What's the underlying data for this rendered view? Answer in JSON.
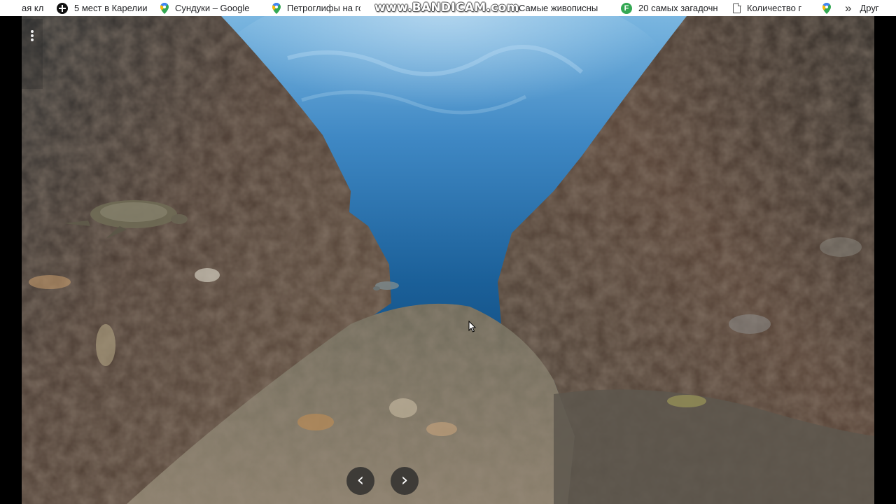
{
  "bookmarks": {
    "items": [
      {
        "label": "ая кл",
        "icon": "none"
      },
      {
        "label": "5 мест в Карелии",
        "icon": "cross-circle-icon"
      },
      {
        "label": "Сундуки – Google",
        "icon": "maps-pin-icon"
      },
      {
        "label": "Петроглифы на го",
        "icon": "maps-pin-icon"
      },
      {
        "label": "Самые живописны",
        "icon": "none"
      },
      {
        "label": "20 самых загадочн",
        "icon": "f-circle-icon"
      },
      {
        "label": "Количество г",
        "icon": "document-icon"
      },
      {
        "label": "Друг",
        "icon": "none"
      }
    ],
    "overflow_glyph": "»"
  },
  "watermark": "www.BANDICAM.com",
  "panorama": {
    "menu_icon": "more-vert-icon",
    "prev_glyph": "‹",
    "next_glyph": "›",
    "colors": {
      "water_top": "#5fa3d6",
      "water_deep": "#0f3f6e",
      "rock_dark": "#3a3029",
      "rock_mid": "#5b4a3d",
      "rock_light": "#8a7f6c"
    }
  }
}
